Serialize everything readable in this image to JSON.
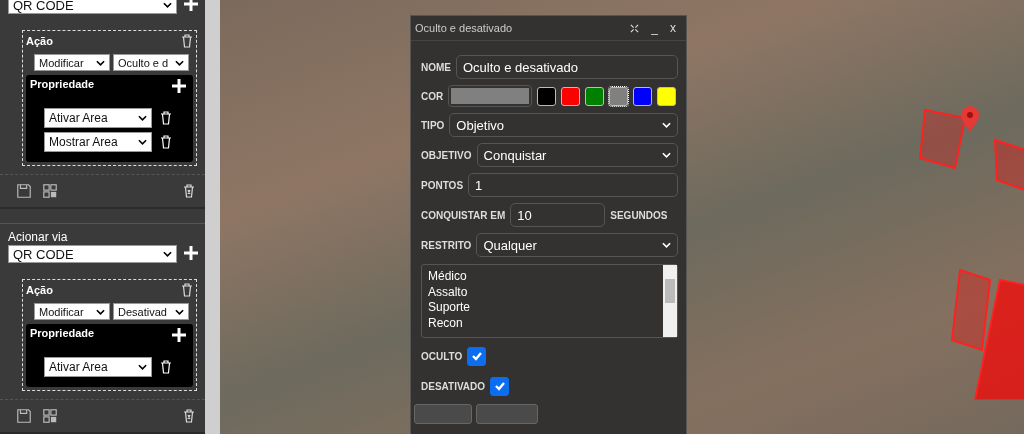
{
  "sidebar": {
    "triggers": [
      {
        "via": "QR CODE",
        "actions": [
          {
            "title": "Ação",
            "type": "Modificar",
            "value": "Oculto e d",
            "property_title": "Propriedade",
            "properties": [
              "Ativar Area",
              "Mostrar Area"
            ]
          }
        ]
      },
      {
        "via_label": "Acionar via",
        "via": "QR CODE",
        "actions": [
          {
            "title": "Ação",
            "type": "Modificar",
            "value": "Desativad",
            "property_title": "Propriedade",
            "properties": [
              "Ativar Area"
            ]
          }
        ]
      }
    ]
  },
  "dialog": {
    "title": "Oculto e desativado",
    "minimize": "_",
    "close": "x",
    "name": {
      "label": "NOME",
      "value": "Oculto e desativado"
    },
    "color": {
      "label": "COR",
      "palette": [
        {
          "color": "#000000",
          "selected": false
        },
        {
          "color": "#ff0000",
          "selected": false
        },
        {
          "color": "#008000",
          "selected": false
        },
        {
          "color": "#808080",
          "selected": true
        },
        {
          "color": "#0000ff",
          "selected": false
        },
        {
          "color": "#ffff00",
          "selected": false
        }
      ]
    },
    "type": {
      "label": "TIPO",
      "value": "Objetivo"
    },
    "objective": {
      "label": "OBJETIVO",
      "value": "Conquistar"
    },
    "points": {
      "label": "PONTOS",
      "value": "1"
    },
    "capture": {
      "label": "CONQUISTAR EM",
      "value": "10",
      "unit": "SEGUNDOS"
    },
    "restricted": {
      "label": "RESTRITO",
      "value": "Qualquer"
    },
    "classes": [
      "Médico",
      "Assalto",
      "Suporte",
      "Recon"
    ],
    "flags": [
      {
        "label": "OCULTO",
        "checked": true
      },
      {
        "label": "DESATIVADO",
        "checked": true
      }
    ]
  }
}
